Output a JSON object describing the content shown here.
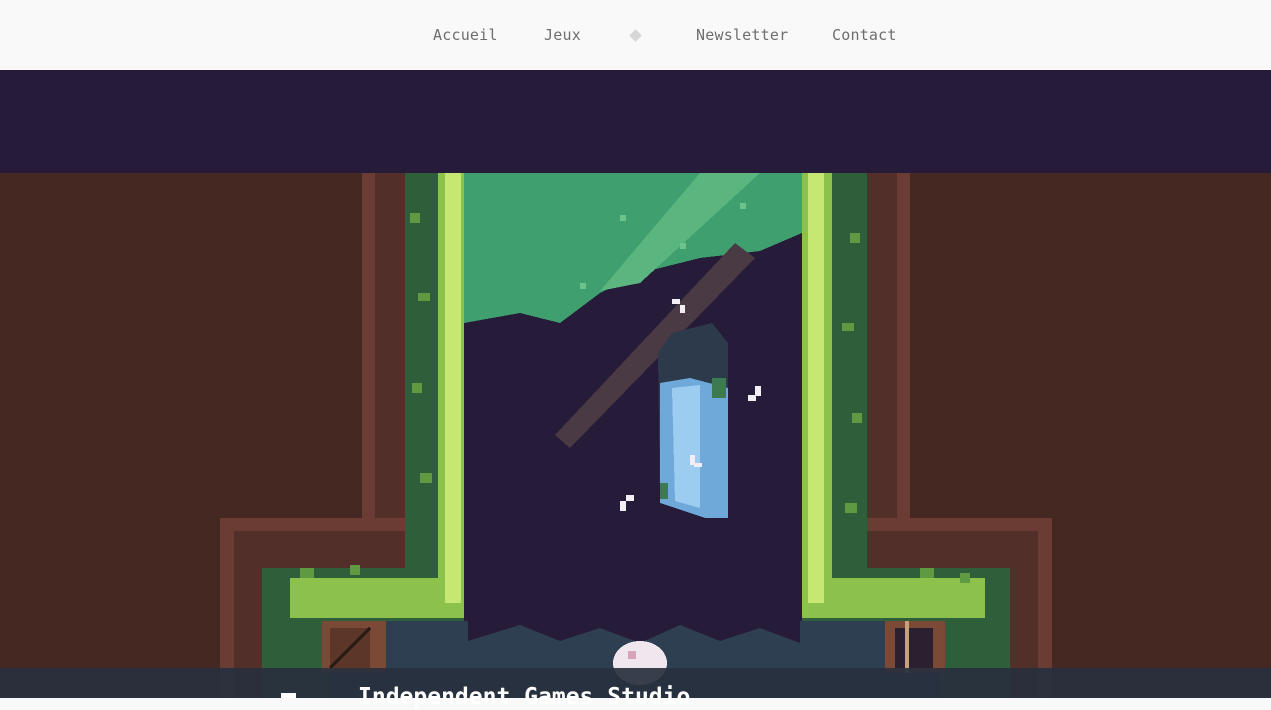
{
  "nav": {
    "items": [
      {
        "label": "Accueil"
      },
      {
        "label": "Jeux"
      },
      {
        "label": "Newsletter"
      },
      {
        "label": "Contact"
      }
    ],
    "separator_icon": "diamond-icon"
  },
  "hero": {
    "title": "Independent Games Studio",
    "colors": {
      "sky": "#261b38",
      "dirt": "#452822",
      "grass": "#40a070",
      "moss": "#b7e36a",
      "crystal": "#6ea9da",
      "footer": "#28303e"
    }
  }
}
